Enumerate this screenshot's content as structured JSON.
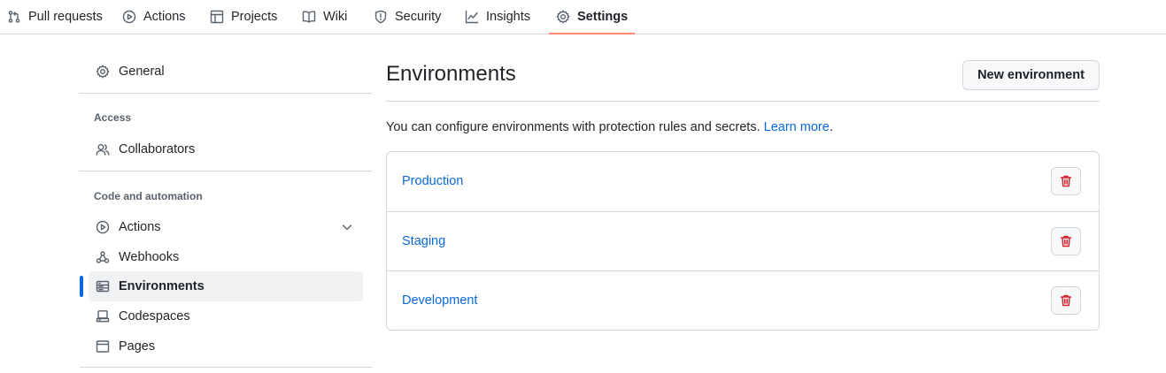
{
  "topnav": {
    "tabs": [
      {
        "label": "Pull requests",
        "icon": "pull-request-icon"
      },
      {
        "label": "Actions",
        "icon": "play-icon"
      },
      {
        "label": "Projects",
        "icon": "table-icon"
      },
      {
        "label": "Wiki",
        "icon": "book-icon"
      },
      {
        "label": "Security",
        "icon": "shield-icon"
      },
      {
        "label": "Insights",
        "icon": "graph-icon"
      },
      {
        "label": "Settings",
        "icon": "gear-icon",
        "active": true
      }
    ]
  },
  "sidebar": {
    "general": "General",
    "access_heading": "Access",
    "collaborators": "Collaborators",
    "code_heading": "Code and automation",
    "actions": "Actions",
    "webhooks": "Webhooks",
    "environments": "Environments",
    "codespaces": "Codespaces",
    "pages": "Pages",
    "selected": "Environments"
  },
  "main": {
    "title": "Environments",
    "new_button": "New environment",
    "description": "You can configure environments with protection rules and secrets. ",
    "learn_more": "Learn more",
    "period": ".",
    "environments": [
      "Production",
      "Staging",
      "Development"
    ]
  },
  "colors": {
    "accent": "#0969da",
    "active_tab_underline": "#fd8c73",
    "danger": "#d1242f",
    "border": "#d0d7de"
  }
}
